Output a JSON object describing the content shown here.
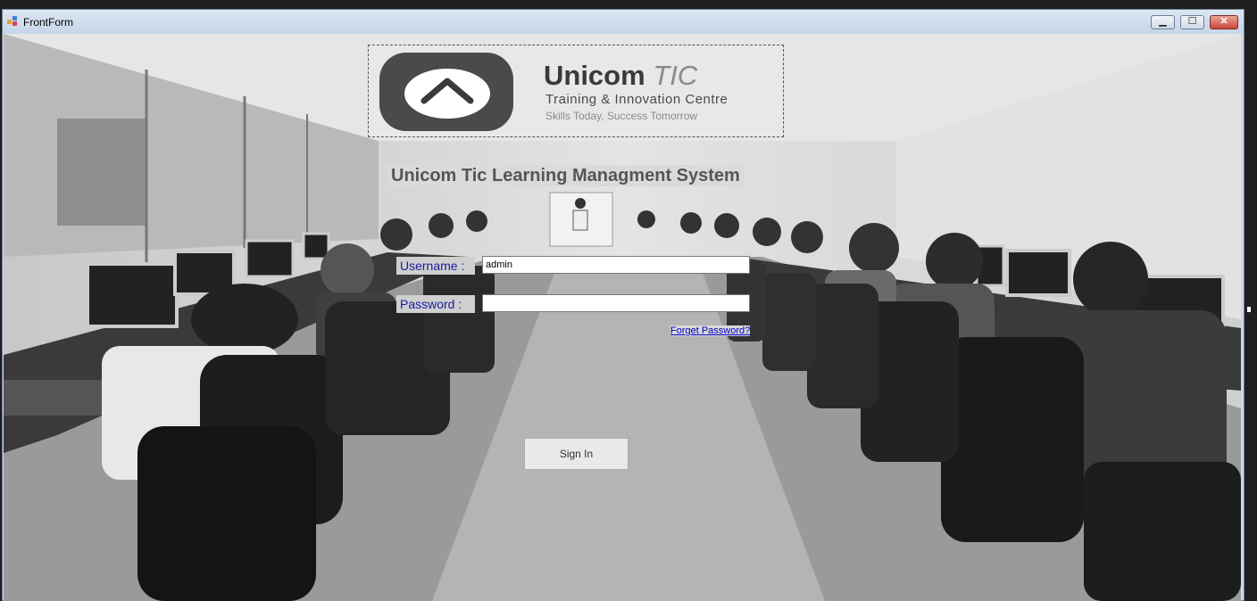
{
  "window": {
    "title": "FrontForm",
    "controls": {
      "minimize": "▁",
      "maximize": "☐",
      "close": "✕"
    }
  },
  "logo": {
    "name": "Unicom",
    "name_accent": "TIC",
    "tagline": "Training & Innovation Centre",
    "slogan": "Skills Today, Success Tomorrow"
  },
  "login": {
    "system_title": "Unicom Tic Learning Managment System",
    "username_label": "Username :",
    "username_value": "admin",
    "password_label": "Password :",
    "password_value": "",
    "forgot_link": "Forget Password?",
    "signin_button": "Sign In"
  },
  "colors": {
    "label_text": "#1c1c9c",
    "link": "#0000cc",
    "close_button": "#c9463a"
  }
}
